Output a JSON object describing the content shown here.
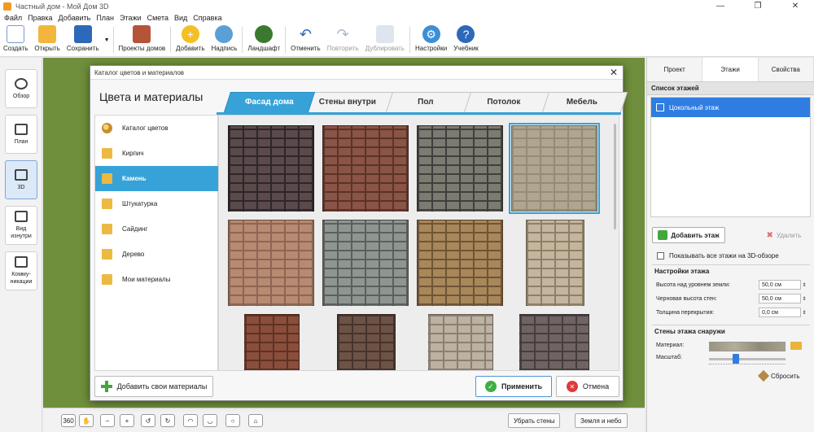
{
  "window": {
    "title": "Частный дом - Мой Дом 3D",
    "controls": [
      "—",
      "❐",
      "✕"
    ]
  },
  "menu": [
    "Файл",
    "Правка",
    "Добавить",
    "План",
    "Этажи",
    "Смета",
    "Вид",
    "Справка"
  ],
  "toolbar": {
    "create": "Создать",
    "open": "Открыть",
    "save": "Сохранить",
    "projects": "Проекты домов",
    "add": "Добавить",
    "label": "Надпись",
    "landscape": "Ландшафт",
    "undo": "Отменить",
    "redo": "Повторить",
    "duplicate": "Дублировать",
    "settings": "Настройки",
    "tutorial": "Учебник"
  },
  "left_panel": {
    "items": [
      {
        "label": "Обзор",
        "icon": "eye-icon",
        "active": false
      },
      {
        "label": "План",
        "icon": "plan-icon",
        "active": false
      },
      {
        "label": "3D",
        "icon": "cube-icon",
        "active": true
      },
      {
        "label": "Вид изнутри",
        "icon": "interior-view-icon",
        "active": false
      },
      {
        "label": "Комму-никации",
        "icon": "utilities-icon",
        "active": false
      }
    ]
  },
  "dialog": {
    "title": "Каталог цветов и материалов",
    "heading": "Цвета и материалы",
    "tabs": [
      {
        "label": "Фасад дома",
        "active": true
      },
      {
        "label": "Стены внутри",
        "active": false
      },
      {
        "label": "Пол",
        "active": false
      },
      {
        "label": "Потолок",
        "active": false
      },
      {
        "label": "Мебель",
        "active": false
      }
    ],
    "categories": [
      {
        "label": "Каталог цветов",
        "icon": "palette-icon",
        "active": false
      },
      {
        "label": "Кирпич",
        "icon": "folder-icon",
        "active": false
      },
      {
        "label": "Камень",
        "icon": "folder-icon",
        "active": true
      },
      {
        "label": "Штукатурка",
        "icon": "folder-icon",
        "active": false
      },
      {
        "label": "Сайдинг",
        "icon": "folder-icon",
        "active": false
      },
      {
        "label": "Дерево",
        "icon": "folder-icon",
        "active": false
      },
      {
        "label": "Мои материалы",
        "icon": "folder-icon",
        "active": false
      }
    ],
    "textures": [
      {
        "name": "stone-dark-purple",
        "base": "#5a4a4c",
        "line": "#2e2628",
        "selected": false
      },
      {
        "name": "stone-red-brown",
        "base": "#8a5446",
        "line": "#5b3329",
        "selected": false
      },
      {
        "name": "stone-grey-slate",
        "base": "#7b7b72",
        "line": "#3f403b",
        "selected": false
      },
      {
        "name": "stone-beige-smooth",
        "base": "#b0a58f",
        "line": "#958b77",
        "selected": true
      },
      {
        "name": "stone-salmon",
        "base": "#b78a72",
        "line": "#8d6654",
        "selected": false
      },
      {
        "name": "stone-blue-grey",
        "base": "#8f9590",
        "line": "#5a605b",
        "selected": false
      },
      {
        "name": "stone-sand-brick",
        "base": "#a8875a",
        "line": "#6e5535",
        "selected": false
      },
      {
        "name": "stone-cream-slate",
        "base": "#c4b59e",
        "line": "#8e8068",
        "selected": false
      },
      {
        "name": "stone-rust",
        "base": "#8a4e3b",
        "line": "#5d3224",
        "selected": false
      },
      {
        "name": "stone-brown-small",
        "base": "#6d5246",
        "line": "#46342c",
        "selected": false
      },
      {
        "name": "stone-light-rubble",
        "base": "#bdb2a2",
        "line": "#8a7f70",
        "selected": false
      },
      {
        "name": "stone-grey-rubble",
        "base": "#6f6462",
        "line": "#463e3d",
        "selected": false
      }
    ],
    "add_materials_button": "Добавить свои материалы",
    "apply_button": "Применить",
    "cancel_button": "Отмена",
    "close": "✕"
  },
  "right_panel": {
    "tabs": [
      {
        "label": "Проект",
        "active": false
      },
      {
        "label": "Этажи",
        "active": true
      },
      {
        "label": "Свойства",
        "active": false
      }
    ],
    "floor_list_title": "Список этажей",
    "floors": [
      "Цокольный этаж"
    ],
    "add_floor": "Добавить этаж",
    "delete_floor": "Удалить",
    "show_all_floors": "Показывать все этажи на 3D-обзоре",
    "floor_settings_title": "Настройки этажа",
    "fields": [
      {
        "label": "Высота над уровнем земли:",
        "value": "50,0 см"
      },
      {
        "label": "Черновая высота стен:",
        "value": "50,0 см"
      },
      {
        "label": "Толщина перекрытия:",
        "value": "0,0 см"
      }
    ],
    "outer_walls_title": "Стены этажа снаружи",
    "material_label": "Материал:",
    "scale_label": "Масштаб:",
    "scale_value": 0.35,
    "reset": "Сбросить"
  },
  "bottom_bar": {
    "hide_walls": "Убрать стены",
    "ground_sky": "Земля и небо"
  }
}
